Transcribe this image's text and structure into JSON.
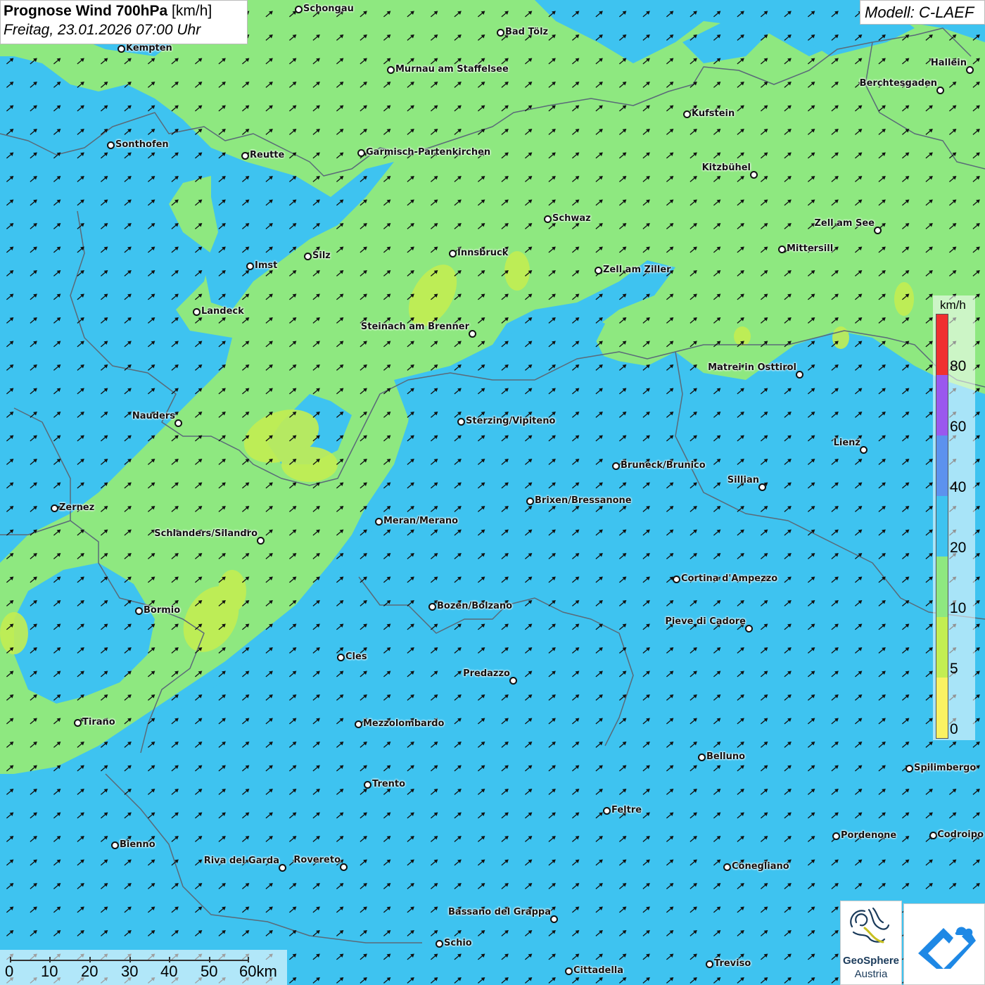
{
  "header": {
    "title_bold": "Prognose Wind 700hPa",
    "title_unit": "[km/h]",
    "date": "Freitag, 23.01.2026 07:00 Uhr"
  },
  "model": {
    "label": "Modell: C-LAEF"
  },
  "legend": {
    "unit": "km/h",
    "ticks": [
      "80",
      "60",
      "40",
      "20",
      "10",
      "5",
      "0"
    ],
    "colors": [
      "#f03030",
      "#9a58ee",
      "#5c92ee",
      "#3ec3f0",
      "#8ee880",
      "#c3ee52",
      "#faf262"
    ]
  },
  "scale": {
    "labels": [
      "0",
      "10",
      "20",
      "30",
      "40",
      "50",
      "60km"
    ]
  },
  "logo": {
    "name": "GeoSphere",
    "sub": "Austria"
  },
  "colors": {
    "calm": "#8ee880",
    "moderate": "#3ec3f0",
    "strong": "#5c92ee",
    "weak": "#c3ee52",
    "arrows": "#111111",
    "borders": "#5a6a78"
  },
  "cities": [
    {
      "name": "Schongau"
    },
    {
      "name": "Bad Tölz"
    },
    {
      "name": "Kempten"
    },
    {
      "name": "Murnau am Staffelsee"
    },
    {
      "name": "Hallein"
    },
    {
      "name": "Berchtesgaden"
    },
    {
      "name": "Kufstein"
    },
    {
      "name": "Sonthofen"
    },
    {
      "name": "Reutte"
    },
    {
      "name": "Garmisch-Partenkirchen"
    },
    {
      "name": "Kitzbühel"
    },
    {
      "name": "Schwaz"
    },
    {
      "name": "Zell am See"
    },
    {
      "name": "Innsbruck"
    },
    {
      "name": "Mittersill"
    },
    {
      "name": "Silz"
    },
    {
      "name": "Imst"
    },
    {
      "name": "Zell am Ziller"
    },
    {
      "name": "Landeck"
    },
    {
      "name": "Steinach am Brenner"
    },
    {
      "name": "Matrei in Osttirol"
    },
    {
      "name": "Nauders"
    },
    {
      "name": "Sterzing/Vipiteno"
    },
    {
      "name": "Lienz"
    },
    {
      "name": "Bruneck/Brunico"
    },
    {
      "name": "Sillian"
    },
    {
      "name": "Brixen/Bressanone"
    },
    {
      "name": "Zernez"
    },
    {
      "name": "Meran/Merano"
    },
    {
      "name": "Schlanders/Silandro"
    },
    {
      "name": "Cortina d'Ampezzo"
    },
    {
      "name": "Bozen/Bolzano"
    },
    {
      "name": "Bormio"
    },
    {
      "name": "Pieve di Cadore"
    },
    {
      "name": "Cles"
    },
    {
      "name": "Predazzo"
    },
    {
      "name": "Tirano"
    },
    {
      "name": "Mezzolombardo"
    },
    {
      "name": "Belluno"
    },
    {
      "name": "Spilimbergo"
    },
    {
      "name": "Trento"
    },
    {
      "name": "Feltre"
    },
    {
      "name": "Pordenone"
    },
    {
      "name": "Codroipo"
    },
    {
      "name": "Bienno"
    },
    {
      "name": "Riva del Garda"
    },
    {
      "name": "Rovereto"
    },
    {
      "name": "Conegliano"
    },
    {
      "name": "Bassano del Grappa"
    },
    {
      "name": "Schio"
    },
    {
      "name": "Treviso"
    },
    {
      "name": "Cittadella"
    }
  ]
}
